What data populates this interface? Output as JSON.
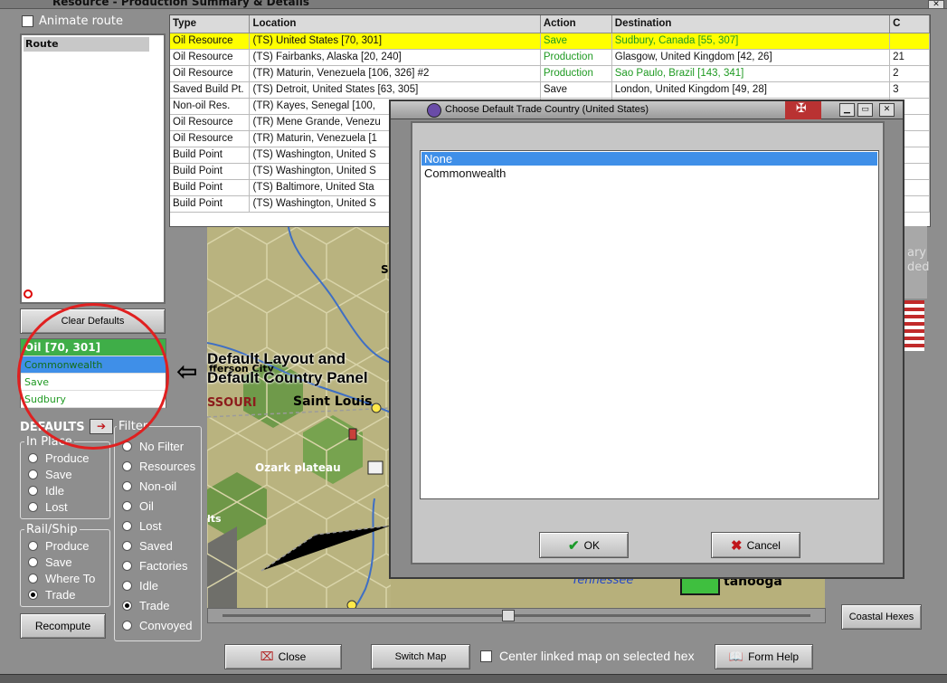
{
  "window": {
    "title": "Resource - Production Summary & Details",
    "close_icon": "✕"
  },
  "left": {
    "animate_route": "Animate route",
    "route_header": "Route",
    "clear_defaults": "Clear Defaults",
    "defaults_list": {
      "header": "Oil [70, 301]",
      "items": [
        "Commonwealth",
        "Save",
        "Sudbury"
      ]
    },
    "defaults_label": "DEFAULTS",
    "defaults_arrow": "➔",
    "in_place": {
      "title": "In Place",
      "options": [
        "Produce",
        "Save",
        "Idle",
        "Lost"
      ]
    },
    "rail_ship": {
      "title": "Rail/Ship",
      "options": [
        "Produce",
        "Save",
        "Where To",
        "Trade"
      ],
      "selected": "Trade"
    },
    "filter": {
      "title": "Filter",
      "options": [
        "No Filter",
        "Resources",
        "Non-oil",
        "Oil",
        "Lost",
        "Saved",
        "Factories",
        "Idle",
        "Trade",
        "Convoyed"
      ],
      "selected": "Trade"
    },
    "recompute": "Recompute"
  },
  "annotation": {
    "arrow": "⇦",
    "line1": "Default Layout and",
    "line2": "Default Country Panel"
  },
  "table": {
    "headers": [
      "Type",
      "Location",
      "Action",
      "Destination",
      "C"
    ],
    "rows": [
      [
        "Oil Resource",
        "(TS) United States [70, 301]",
        "Save",
        "Sudbury, Canada [55, 307]",
        ""
      ],
      [
        "Oil Resource",
        "(TS) Fairbanks, Alaska [20, 240]",
        "Production",
        "Glasgow, United Kingdom [42, 26]",
        "21"
      ],
      [
        "Oil Resource",
        "(TR) Maturin, Venezuela [106, 326] #2",
        "Production",
        "Sao Paulo, Brazil [143, 341]",
        "2"
      ],
      [
        "Saved Build Pt.",
        "(TS) Detroit, United States [63, 305]",
        "Save",
        "London, United Kingdom [49, 28]",
        "3"
      ],
      [
        "Non-oil Res.",
        "(TR) Kayes, Senegal [100,",
        "",
        "",
        ""
      ],
      [
        "Oil Resource",
        "(TR) Mene Grande, Venezu",
        "",
        "",
        ""
      ],
      [
        "Oil Resource",
        "(TR) Maturin, Venezuela [1",
        "",
        "",
        ""
      ],
      [
        "Build Point",
        "(TS) Washington, United S",
        "",
        "",
        ""
      ],
      [
        "Build Point",
        "(TS) Washington, United S",
        "",
        "",
        ""
      ],
      [
        "Build Point",
        "(TS) Baltimore, United Sta",
        "",
        "",
        ""
      ],
      [
        "Build Point",
        "(TS) Washington, United S",
        "",
        "",
        ""
      ]
    ]
  },
  "map": {
    "labels": [
      "fferson City",
      "SSOURI",
      "Saint Louis",
      "Ozark plateau",
      "lts",
      "S",
      "Tennessee",
      "tanooga"
    ]
  },
  "right": {
    "partial_text_1": "ary",
    "partial_text_2": "ded",
    "coastal_hexes": "Coastal Hexes"
  },
  "bottom": {
    "close": "Close",
    "switch_map": "Switch Map",
    "center_linked": "Center linked map on selected hex",
    "form_help": "Form Help"
  },
  "dialog": {
    "title": "Choose Default Trade Country (United States)",
    "options": [
      "None",
      "Commonwealth"
    ],
    "selected": "None",
    "ok": "OK",
    "cancel": "Cancel"
  },
  "colors": {
    "selection": "#3f8fe8",
    "highlight_row": "#ffff00",
    "green_text": "#1f9a22",
    "annotation_red": "#e02020"
  }
}
